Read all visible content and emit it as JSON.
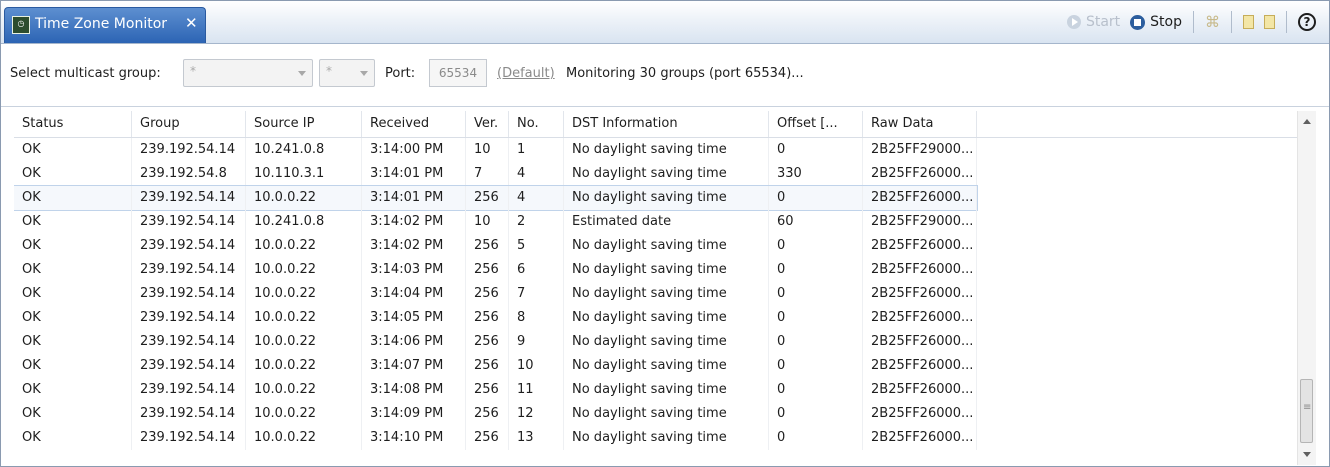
{
  "tab": {
    "title": "Time Zone Monitor",
    "icon": "time-zone-monitor-icon",
    "close": "✕"
  },
  "toolbar": {
    "start_label": "Start",
    "stop_label": "Stop"
  },
  "filter": {
    "select_label": "Select multicast group:",
    "group_value": "*",
    "subgroup_value": "*",
    "port_label": "Port:",
    "port_value": "65534",
    "default_link": "(Default)",
    "status": "Monitoring 30 groups (port 65534)..."
  },
  "table": {
    "columns": [
      "Status",
      "Group",
      "Source IP",
      "Received",
      "Ver.",
      "No.",
      "DST Information",
      "Offset [...",
      "Raw Data"
    ],
    "selected_row": 2,
    "rows": [
      [
        "OK",
        "239.192.54.14",
        "10.241.0.8",
        "3:14:00 PM",
        "10",
        "1",
        "No daylight saving time",
        "0",
        "2B25FF29000..."
      ],
      [
        "OK",
        "239.192.54.8",
        "10.110.3.1",
        "3:14:01 PM",
        "7",
        "4",
        "No daylight saving time",
        "330",
        "2B25FF26000..."
      ],
      [
        "OK",
        "239.192.54.14",
        "10.0.0.22",
        "3:14:01 PM",
        "256",
        "4",
        "No daylight saving time",
        "0",
        "2B25FF26000..."
      ],
      [
        "OK",
        "239.192.54.14",
        "10.241.0.8",
        "3:14:02 PM",
        "10",
        "2",
        "Estimated date",
        "60",
        "2B25FF29000..."
      ],
      [
        "OK",
        "239.192.54.14",
        "10.0.0.22",
        "3:14:02 PM",
        "256",
        "5",
        "No daylight saving time",
        "0",
        "2B25FF26000..."
      ],
      [
        "OK",
        "239.192.54.14",
        "10.0.0.22",
        "3:14:03 PM",
        "256",
        "6",
        "No daylight saving time",
        "0",
        "2B25FF26000..."
      ],
      [
        "OK",
        "239.192.54.14",
        "10.0.0.22",
        "3:14:04 PM",
        "256",
        "7",
        "No daylight saving time",
        "0",
        "2B25FF26000..."
      ],
      [
        "OK",
        "239.192.54.14",
        "10.0.0.22",
        "3:14:05 PM",
        "256",
        "8",
        "No daylight saving time",
        "0",
        "2B25FF26000..."
      ],
      [
        "OK",
        "239.192.54.14",
        "10.0.0.22",
        "3:14:06 PM",
        "256",
        "9",
        "No daylight saving time",
        "0",
        "2B25FF26000..."
      ],
      [
        "OK",
        "239.192.54.14",
        "10.0.0.22",
        "3:14:07 PM",
        "256",
        "10",
        "No daylight saving time",
        "0",
        "2B25FF26000..."
      ],
      [
        "OK",
        "239.192.54.14",
        "10.0.0.22",
        "3:14:08 PM",
        "256",
        "11",
        "No daylight saving time",
        "0",
        "2B25FF26000..."
      ],
      [
        "OK",
        "239.192.54.14",
        "10.0.0.22",
        "3:14:09 PM",
        "256",
        "12",
        "No daylight saving time",
        "0",
        "2B25FF26000..."
      ],
      [
        "OK",
        "239.192.54.14",
        "10.0.0.22",
        "3:14:10 PM",
        "256",
        "13",
        "No daylight saving time",
        "0",
        "2B25FF26000..."
      ]
    ]
  },
  "colors": {
    "tab": "#2c64b4",
    "selected_row": "#f5f8fc"
  }
}
